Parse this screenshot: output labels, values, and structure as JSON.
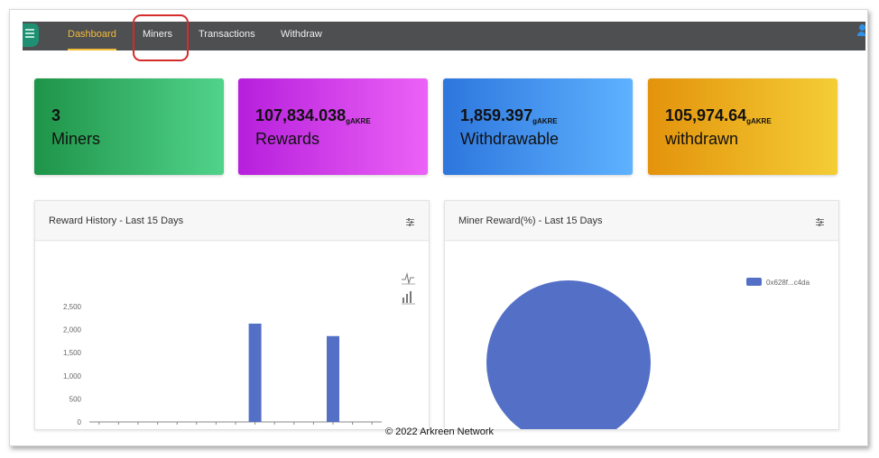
{
  "nav": {
    "items": [
      {
        "label": "Dashboard",
        "active": true
      },
      {
        "label": "Miners",
        "active": false
      },
      {
        "label": "Transactions",
        "active": false
      },
      {
        "label": "Withdraw",
        "active": false
      }
    ]
  },
  "stats": [
    {
      "value": "3",
      "unit": "",
      "label": "Miners",
      "gradient": [
        "#1e9448",
        "#51d38b"
      ]
    },
    {
      "value": "107,834.038",
      "unit": "gAKRE",
      "label": "Rewards",
      "gradient": [
        "#b61fdc",
        "#ec62f6"
      ]
    },
    {
      "value": "1,859.397",
      "unit": "gAKRE",
      "label": "Withdrawable",
      "gradient": [
        "#2d76dd",
        "#5eb2ff"
      ]
    },
    {
      "value": "105,974.64",
      "unit": "gAKRE",
      "label": "withdrawn",
      "gradient": [
        "#e3930c",
        "#f4cd35"
      ]
    }
  ],
  "reward_history": {
    "title": "Reward History - Last 15 Days"
  },
  "miner_reward": {
    "title": "Miner Reward(%) - Last 15 Days",
    "legend_label": "0x628f...c4da",
    "color": "#5470c6"
  },
  "chart_data": [
    {
      "type": "bar",
      "title": "Reward History - Last 15 Days",
      "categories": [
        "",
        "",
        "",
        "",
        "",
        "",
        "",
        "",
        "",
        "",
        "",
        "",
        "",
        "",
        ""
      ],
      "values": [
        0,
        0,
        0,
        0,
        0,
        0,
        0,
        0,
        2130,
        0,
        0,
        0,
        1860,
        0,
        0
      ],
      "y_ticks": [
        "0",
        "500",
        "1,000",
        "1,500",
        "2,000",
        "2,500"
      ],
      "ylim": [
        0,
        2500
      ],
      "color": "#5470c6",
      "grid": false
    },
    {
      "type": "pie",
      "title": "Miner Reward(%) - Last 15 Days",
      "slices": [
        {
          "name": "0x628f...c4da",
          "value": 100
        }
      ],
      "legend": "top-right",
      "color": "#5470c6"
    }
  ],
  "footer": "© 2022 Arkreen Network"
}
